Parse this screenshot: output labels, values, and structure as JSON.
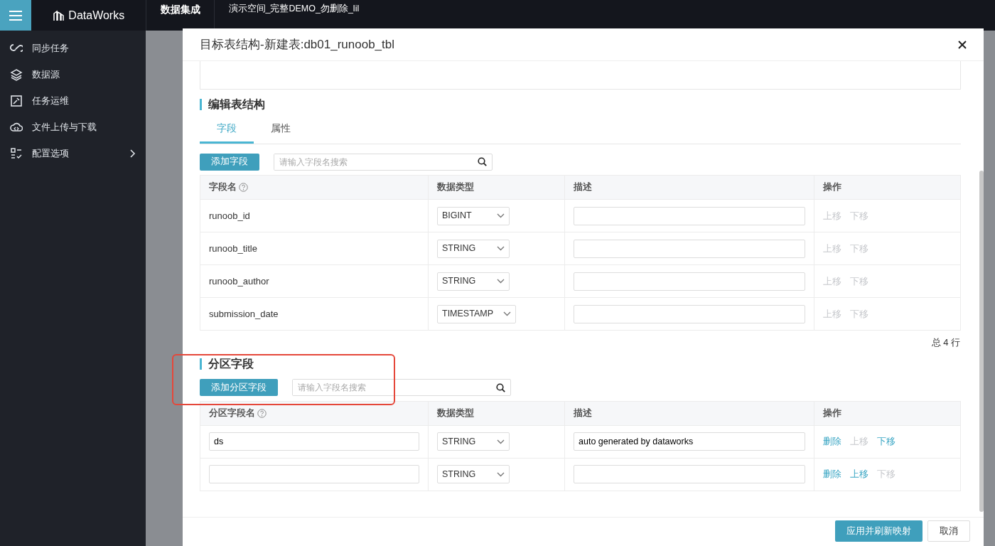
{
  "app": {
    "brand": "DataWorks",
    "nav": "数据集成",
    "workspace": "演示空间_完整DEMO_勿删除_lil"
  },
  "sidebar": {
    "items": [
      {
        "label": "同步任务",
        "has_submenu": false
      },
      {
        "label": "数据源",
        "has_submenu": false
      },
      {
        "label": "任务运维",
        "has_submenu": false
      },
      {
        "label": "文件上传与下载",
        "has_submenu": false
      },
      {
        "label": "配置选项",
        "has_submenu": true
      }
    ]
  },
  "dialog": {
    "title": "目标表结构-新建表:db01_runoob_tbl",
    "section_title": "编辑表结构",
    "tabs": [
      {
        "label": "字段",
        "selected": true
      },
      {
        "label": "属性",
        "selected": false
      }
    ],
    "fields": {
      "add_button": "添加字段",
      "search": {
        "placeholder": "请输入字段名搜索"
      },
      "columns": [
        {
          "label": "字段名",
          "help": true
        },
        {
          "label": "数据类型",
          "help": false
        },
        {
          "label": "描述",
          "help": false
        },
        {
          "label": "操作",
          "help": false
        }
      ],
      "rows": [
        {
          "name": "runoob_id",
          "type": "BIGINT",
          "actions": [
            {
              "label": "上移",
              "disabled": true
            },
            {
              "label": "下移",
              "disabled": true
            }
          ]
        },
        {
          "name": "runoob_title",
          "type": "STRING",
          "actions": [
            {
              "label": "上移",
              "disabled": true
            },
            {
              "label": "下移",
              "disabled": true
            }
          ]
        },
        {
          "name": "runoob_author",
          "type": "STRING",
          "actions": [
            {
              "label": "上移",
              "disabled": true
            },
            {
              "label": "下移",
              "disabled": true
            }
          ]
        },
        {
          "name": "submission_date",
          "type": "TIMESTAMP",
          "actions": [
            {
              "label": "上移",
              "disabled": true
            },
            {
              "label": "下移",
              "disabled": true
            }
          ]
        }
      ],
      "total": "总 4 行"
    },
    "partition": {
      "title": "分区字段",
      "highlighted": true,
      "add_button": "添加分区字段",
      "search": {
        "placeholder": "请输入字段名搜索"
      },
      "columns": [
        {
          "label": "分区字段名",
          "help": true
        },
        {
          "label": "数据类型",
          "help": false
        },
        {
          "label": "描述",
          "help": false
        },
        {
          "label": "操作",
          "help": false
        }
      ],
      "rows": [
        {
          "name": "ds",
          "type": "STRING",
          "description": "auto generated by dataworks",
          "actions": [
            {
              "label": "删除",
              "disabled": false
            },
            {
              "label": "上移",
              "disabled": true
            },
            {
              "label": "下移",
              "disabled": false
            }
          ]
        },
        {
          "type": "STRING",
          "actions": [
            {
              "label": "删除",
              "disabled": false
            },
            {
              "label": "上移",
              "disabled": false
            },
            {
              "label": "下移",
              "disabled": true
            }
          ]
        }
      ]
    },
    "buttons": [
      {
        "label": "应用并刷新映射",
        "kind": "primary"
      },
      {
        "label": "取消",
        "kind": "secondary"
      }
    ]
  }
}
